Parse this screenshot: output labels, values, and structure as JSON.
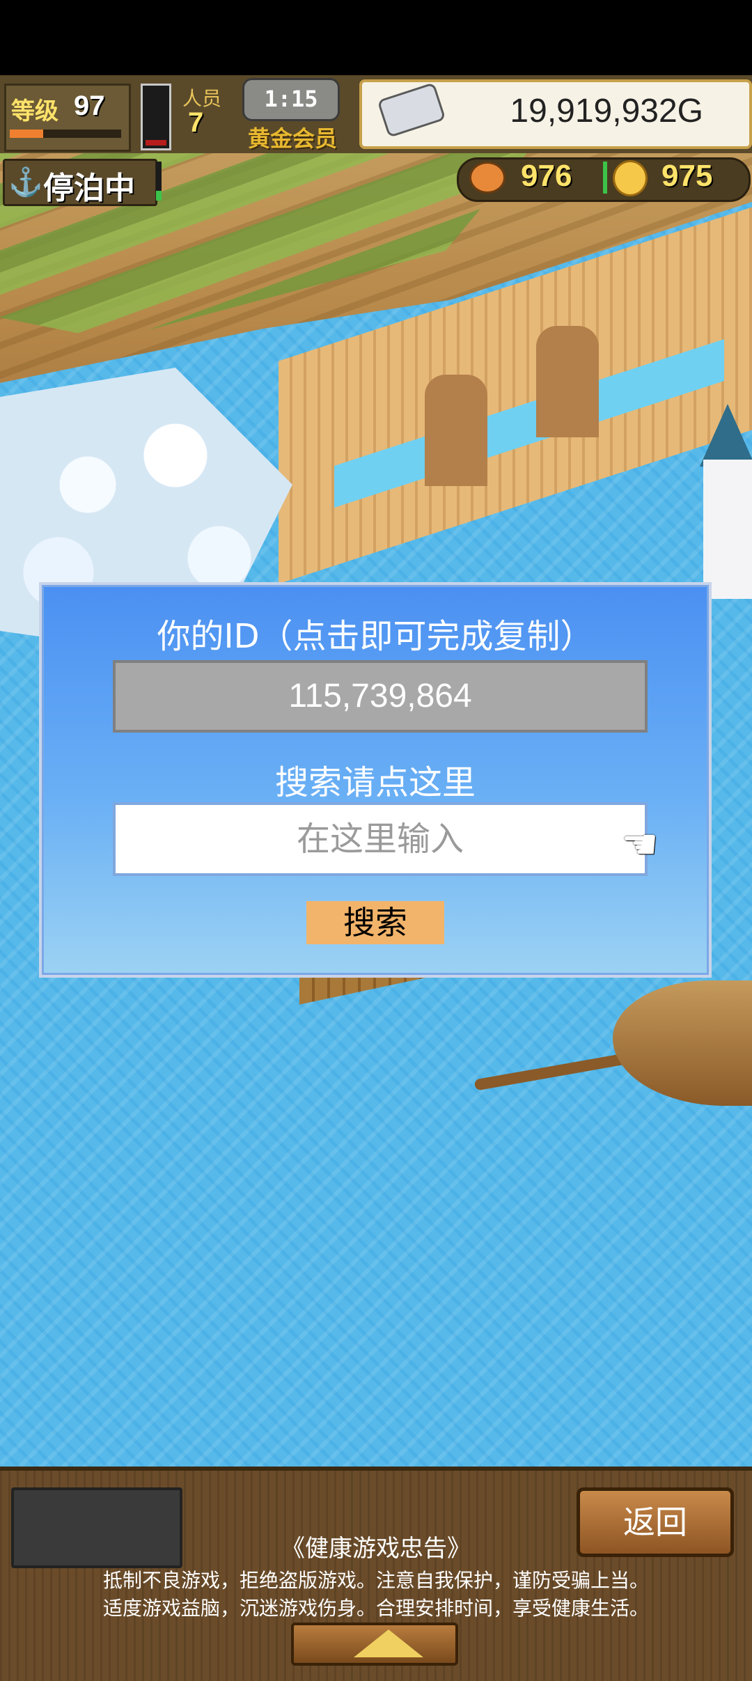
{
  "hud": {
    "level_label": "等级",
    "level": "97",
    "level_progress": 0.3,
    "stamina_fraction": 0.1,
    "staff_label": "人员",
    "staff_count": "7",
    "clock": "1:15",
    "membership": "黄金会员",
    "money": "19,919,932G",
    "status": "停泊中",
    "food": "976",
    "coins": "975"
  },
  "dialog": {
    "title": "你的ID（点击即可完成复制）",
    "id_value": "115,739,864",
    "search_label": "搜索请点这里",
    "search_placeholder": "在这里输入",
    "search_button": "搜索"
  },
  "bottom": {
    "back_button": "返回",
    "notice_title": "《健康游戏忠告》",
    "notice_line1": "抵制不良游戏，拒绝盗版游戏。注意自我保护，谨防受骗上当。",
    "notice_line2": "适度游戏益脑，沉迷游戏伤身。合理安排时间，享受健康生活。"
  },
  "icons": [
    "anchor-icon",
    "ingot-icon",
    "food-icon",
    "coin-icon",
    "pointing-hand-icon",
    "up-arrow-icon"
  ],
  "colors": {
    "dialog_top": "#4b90f2",
    "dialog_bottom": "#9cd2f3",
    "search_button": "#f2b46a",
    "id_box": "#a8a8a8",
    "hud_yellow": "#ffe36a"
  }
}
